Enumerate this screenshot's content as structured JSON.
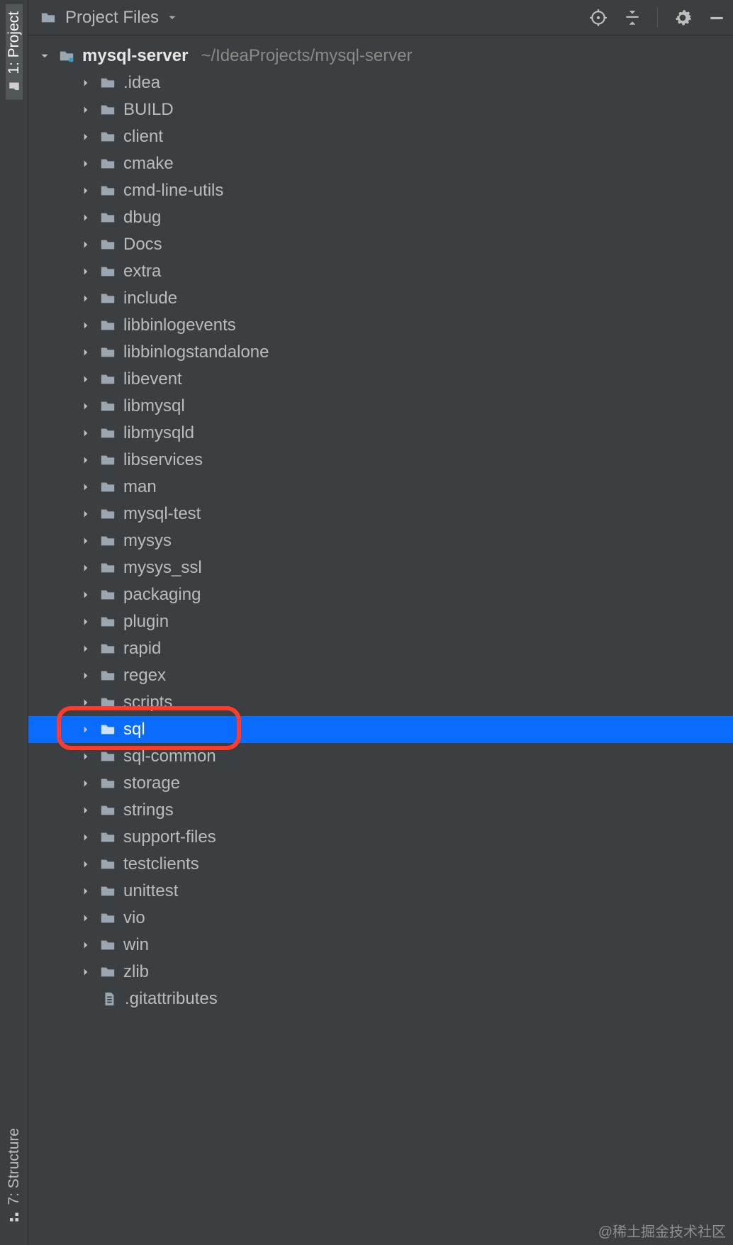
{
  "sideTabs": {
    "project": {
      "label": "1: Project"
    },
    "structure": {
      "label": "7: Structure"
    }
  },
  "toolbar": {
    "dropdown_label": "Project Files"
  },
  "project_root": {
    "name": "mysql-server",
    "path_suffix": "~/IdeaProjects/mysql-server"
  },
  "folders": [
    {
      "name": ".idea"
    },
    {
      "name": "BUILD"
    },
    {
      "name": "client"
    },
    {
      "name": "cmake"
    },
    {
      "name": "cmd-line-utils"
    },
    {
      "name": "dbug"
    },
    {
      "name": "Docs"
    },
    {
      "name": "extra"
    },
    {
      "name": "include"
    },
    {
      "name": "libbinlogevents"
    },
    {
      "name": "libbinlogstandalone"
    },
    {
      "name": "libevent"
    },
    {
      "name": "libmysql"
    },
    {
      "name": "libmysqld"
    },
    {
      "name": "libservices"
    },
    {
      "name": "man"
    },
    {
      "name": "mysql-test"
    },
    {
      "name": "mysys"
    },
    {
      "name": "mysys_ssl"
    },
    {
      "name": "packaging"
    },
    {
      "name": "plugin"
    },
    {
      "name": "rapid"
    },
    {
      "name": "regex"
    },
    {
      "name": "scripts"
    },
    {
      "name": "sql",
      "selected": true,
      "highlighted": true
    },
    {
      "name": "sql-common"
    },
    {
      "name": "storage"
    },
    {
      "name": "strings"
    },
    {
      "name": "support-files"
    },
    {
      "name": "testclients"
    },
    {
      "name": "unittest"
    },
    {
      "name": "vio"
    },
    {
      "name": "win"
    },
    {
      "name": "zlib"
    }
  ],
  "trailing_file": {
    "name": ".gitattributes"
  },
  "watermark": "@稀土掘金技术社区",
  "colors": {
    "selection": "#0a6bff",
    "highlight_ring": "#ff3b30",
    "panel_bg": "#3c3f41"
  }
}
